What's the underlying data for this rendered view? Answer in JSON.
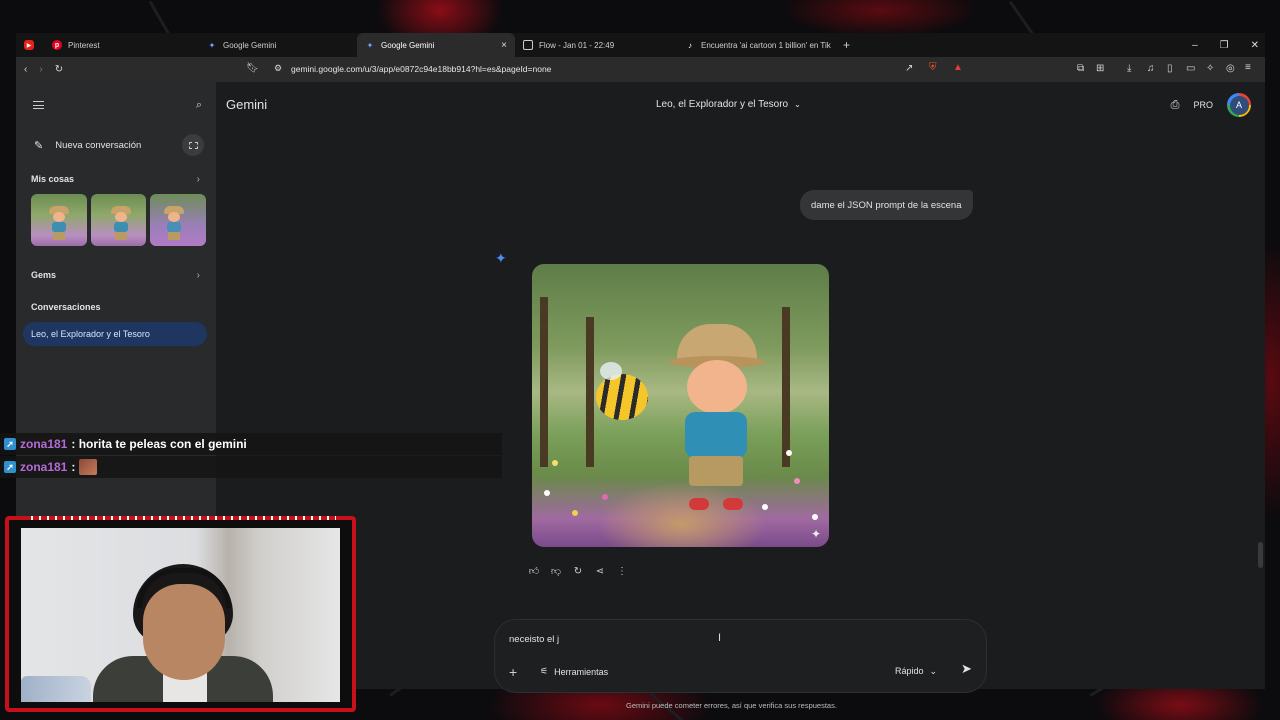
{
  "browser": {
    "tabs": [
      {
        "title": "Pinterest",
        "icon": "pinterest-icon",
        "active": false
      },
      {
        "title": "Google Gemini",
        "icon": "gemini-icon",
        "active": false
      },
      {
        "title": "Google Gemini",
        "icon": "gemini-icon",
        "active": true
      },
      {
        "title": "Flow - Jan 01 - 22:49",
        "icon": "flow-icon",
        "active": false
      },
      {
        "title": "Encuentra 'ai cartoon 1 billion' en Tik",
        "icon": "tiktok-icon",
        "active": false
      }
    ],
    "url": "gemini.google.com/u/3/app/e0872c94e18bb914?hl=es&pageId=none"
  },
  "sidebar": {
    "new_chat": "Nueva conversación",
    "my_stuff": "Mis cosas",
    "gems": "Gems",
    "conversations_header": "Conversaciones",
    "conversations": [
      "Leo, el Explorador y el Tesoro"
    ]
  },
  "header": {
    "brand": "Gemini",
    "conversation_title": "Leo, el Explorador y el Tesoro",
    "plan": "PRO",
    "avatar_letter": "A"
  },
  "chat": {
    "user_message": "dame el JSON prompt de la escena"
  },
  "composer": {
    "text": "neceisto el j",
    "tools_label": "Herramientas",
    "mode_label": "Rápido",
    "disclaimer": "Gemini puede cometer errores, así que verifica sus respuestas."
  },
  "stream_chat": [
    {
      "user": "zona181",
      "message": " : horita te peleas con el gemini"
    },
    {
      "user": "zona181",
      "message": " :"
    }
  ],
  "colors": {
    "accent": "#4c8df6",
    "sidebar_selected": "#1f3760",
    "chat_username": "#b56bd6",
    "cam_border": "#c8101a"
  }
}
